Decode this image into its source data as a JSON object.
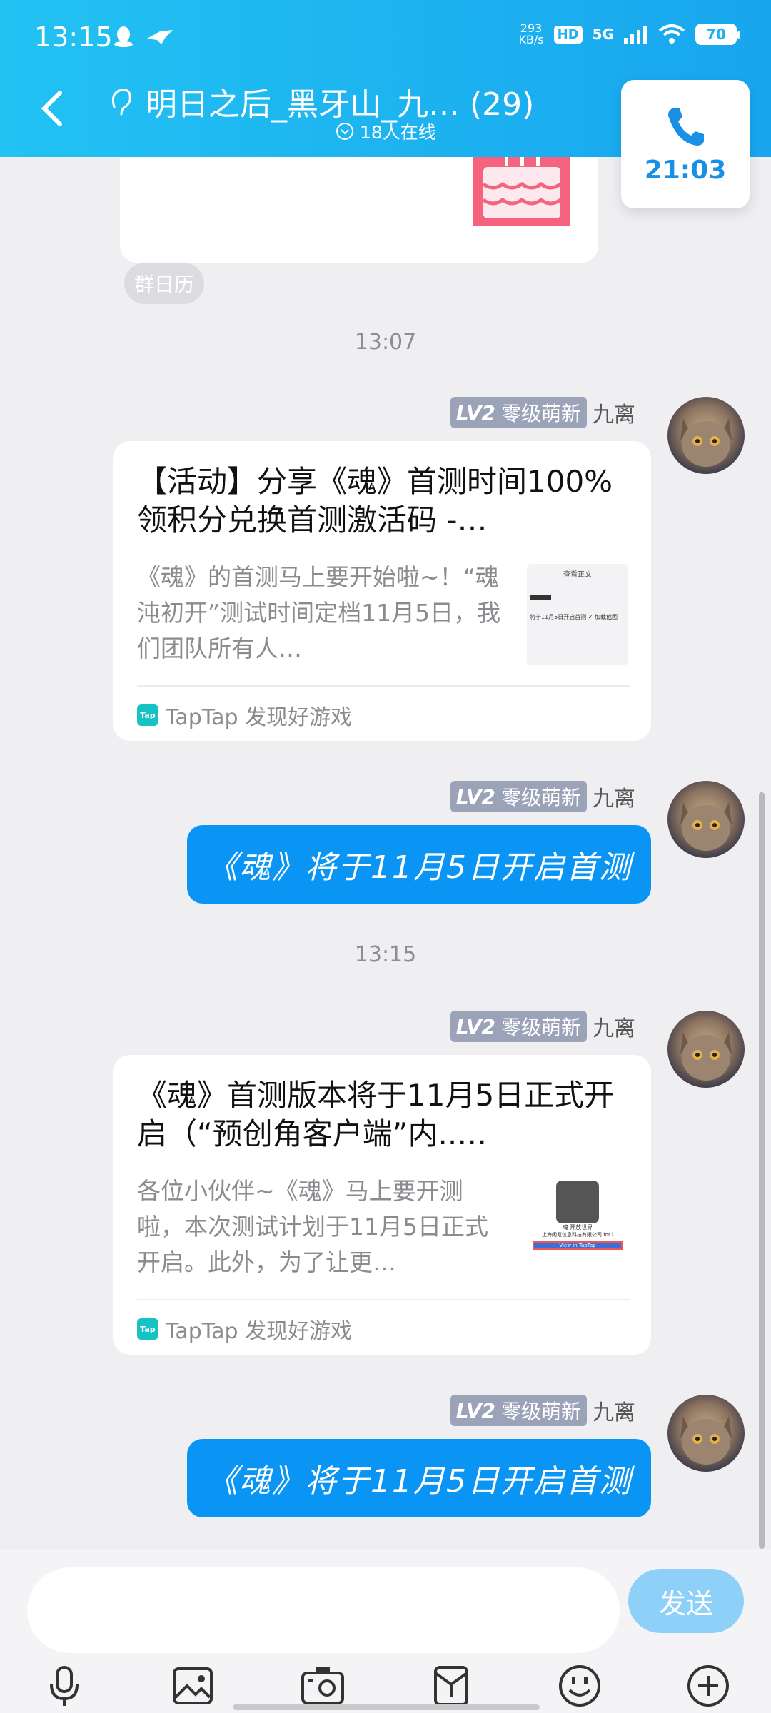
{
  "status": {
    "time": "13:15",
    "speed_top": "293",
    "speed_unit": "KB/s",
    "hd": "HD",
    "net": "5G",
    "battery": "70"
  },
  "header": {
    "title": "明日之后_黑牙山_九…  (29)",
    "online": "18人在线"
  },
  "call": {
    "duration": "21:03"
  },
  "chat": {
    "calendar_label": "群日历",
    "time1": "13:07",
    "time2": "13:15",
    "sender": {
      "level": "LV2",
      "title": "零级萌新",
      "name": "九离"
    },
    "card1": {
      "title": "【活动】分享《魂》首测时间100%领积分兑换首测激活码 -…",
      "desc": "《魂》的首测马上要开始啦~！“魂沌初开”测试时间定档11月5日，我们团队所有人…",
      "source": "TapTap 发现好游戏",
      "thumb_heading": "查看正文",
      "thumb_text": "将于11月5日开启首测 ✓ 加载截图"
    },
    "bubble1": "《魂》将于11月5日开启首测",
    "card2": {
      "title": "《魂》首测版本将于11月5日正式开启（“预创角客户端”内..…",
      "desc": "各位小伙伴~《魂》马上要开测啦，本次测试计划于11月5日正式开启。此外，为了让更…",
      "source": "TapTap 发现好游戏",
      "thumb_line1": "魂 开放世界",
      "thumb_line2": "上海闲氪信息科技有限公司 for i",
      "thumb_btn": "View in TapTap"
    },
    "bubble2": "《魂》将于11月5日开启首测"
  },
  "input": {
    "placeholder": "",
    "send_label": "发送"
  },
  "colors": {
    "header": "#1cb1f0",
    "bubble": "#0a95f5",
    "send": "#8fd0f8"
  }
}
